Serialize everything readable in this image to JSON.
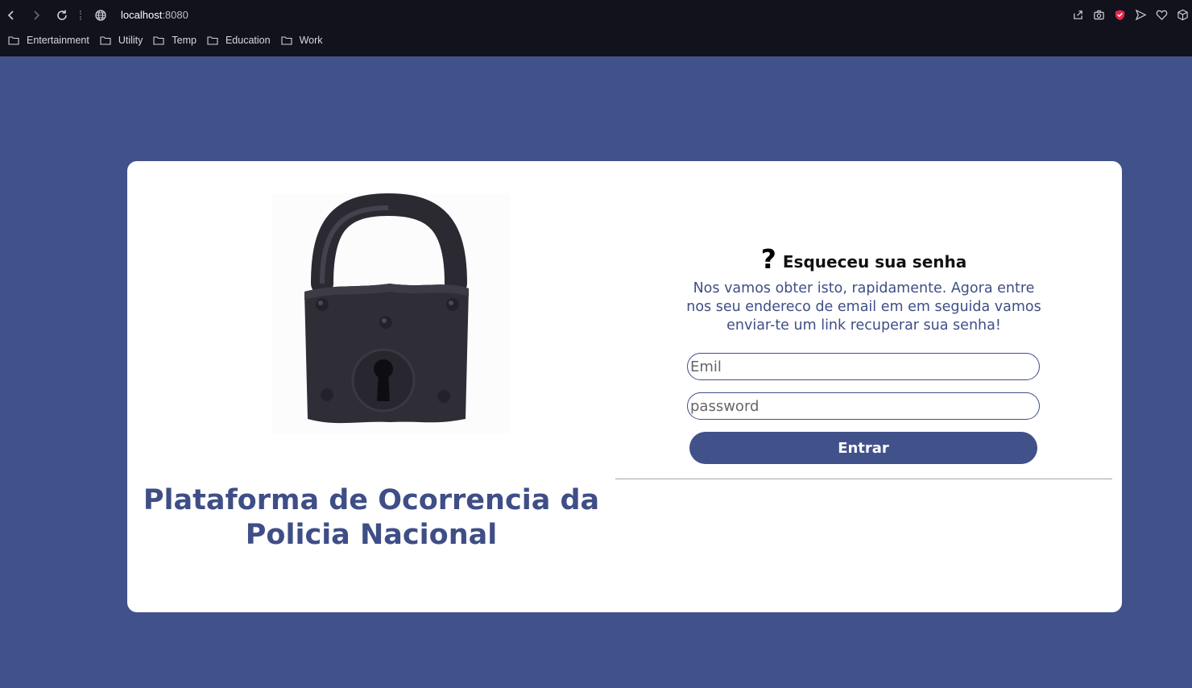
{
  "browser": {
    "url_host": "localhost",
    "url_port": ":8080",
    "bookmarks": [
      "Entertainment",
      "Utility",
      "Temp",
      "Education",
      "Work"
    ]
  },
  "page": {
    "platform_title": "Plataforma de Ocorrencia da Policia Nacional",
    "forgot": {
      "question_mark": "?",
      "title": "Esqueceu sua senha",
      "description": "Nos vamos obter isto, rapidamente. Agora entre nos seu endereco de email em em seguida vamos enviar-te um link recuperar sua senha!"
    },
    "email_placeholder": "Emil",
    "password_placeholder": "password",
    "submit_label": "Entrar"
  },
  "colors": {
    "background": "#41518a",
    "accent": "#3f4e86",
    "card": "#ffffff"
  }
}
